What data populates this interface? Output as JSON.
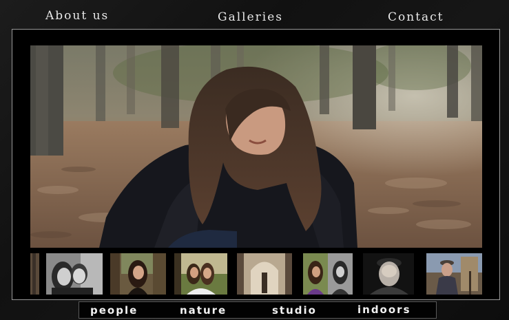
{
  "nav": {
    "about": "About us",
    "galleries": "Galleries",
    "contact": "Contact"
  },
  "hero": {
    "subject": "woman-crouching-in-forest",
    "colors": {
      "ground": "#8b6b50",
      "trees": "#4a4a40",
      "jacket": "#15161c",
      "hair": "#3a2a20"
    }
  },
  "thumbnails": [
    {
      "name": "partial-thumb-edge"
    },
    {
      "name": "couple-bw-portrait"
    },
    {
      "name": "woman-by-tree"
    },
    {
      "name": "two-women-outdoors"
    },
    {
      "name": "sepia-archway-figure"
    },
    {
      "name": "woman-color-and-bw"
    },
    {
      "name": "old-man-dark-portrait"
    },
    {
      "name": "old-man-outdoors"
    }
  ],
  "categories": {
    "people": "people",
    "nature": "nature",
    "studio": "studio",
    "indoors": "indoors"
  }
}
